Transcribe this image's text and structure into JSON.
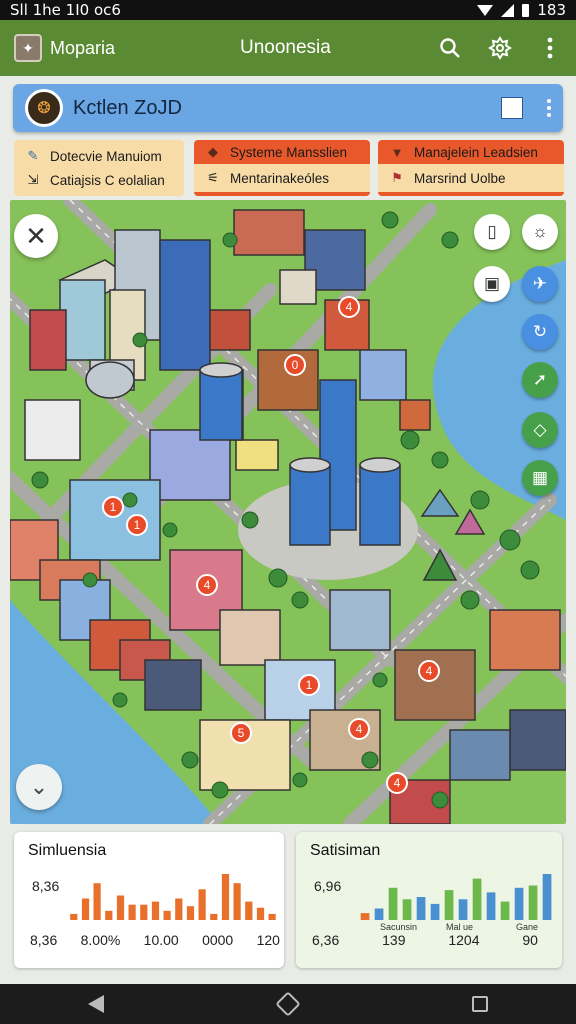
{
  "status_bar": {
    "left_text": "Sll 1he 1I0 oc6",
    "time": "183"
  },
  "app_bar": {
    "app_name": "Moparia",
    "title": "Unoonesia",
    "actions": [
      "search-icon",
      "settings-icon",
      "more-icon"
    ]
  },
  "panel": {
    "title": "Kctlen ZoJD"
  },
  "chips": {
    "left": [
      {
        "label": "Dotecvie Manuiom",
        "icon": "pencil-icon"
      },
      {
        "label": "Catiajsis C eolalian",
        "icon": "export-icon"
      }
    ],
    "middle": [
      {
        "label": "Systeme Mansslien",
        "icon": "shield-icon"
      },
      {
        "label": "Mentarinakeóles",
        "icon": "filter-icon"
      }
    ],
    "right": [
      {
        "label": "Manajelein Leadsien",
        "icon": "badge-icon"
      },
      {
        "label": "Marsrind Uolbe",
        "icon": "flag-icon"
      }
    ]
  },
  "map": {
    "markers": [
      "4",
      "0",
      "1",
      "1",
      "4",
      "1",
      "4",
      "5",
      "4",
      "4"
    ],
    "side_buttons": [
      "device-icon",
      "sun-icon",
      "tablet-icon",
      "wind-icon",
      "refresh-icon",
      "arrow-icon",
      "cube-icon",
      "grid-icon"
    ]
  },
  "cards": {
    "left": {
      "title": "Simluensia",
      "value": "8,36",
      "footer": [
        "8,36",
        "8.00%",
        "10.00",
        "0000",
        "120"
      ],
      "bars": [
        4,
        14,
        24,
        6,
        16,
        10,
        10,
        12,
        6,
        14,
        9,
        20,
        4,
        30,
        24,
        12,
        8,
        4
      ],
      "bar_color": "#e8702a"
    },
    "right": {
      "title": "Satisiman",
      "value": "6,96",
      "footer": [
        "6,36",
        "139",
        "1204",
        "90"
      ],
      "x_labels": [
        "Sacunsin",
        "Mal ue",
        "Gane"
      ],
      "bars": [
        {
          "v": 6,
          "c": "#e8702a"
        },
        {
          "v": 10,
          "c": "#4a90d0"
        },
        {
          "v": 28,
          "c": "#6cb84a"
        },
        {
          "v": 18,
          "c": "#6cb84a"
        },
        {
          "v": 20,
          "c": "#4a90d0"
        },
        {
          "v": 14,
          "c": "#4a90d0"
        },
        {
          "v": 26,
          "c": "#6cb84a"
        },
        {
          "v": 18,
          "c": "#4a90d0"
        },
        {
          "v": 36,
          "c": "#6cb84a"
        },
        {
          "v": 24,
          "c": "#4a90d0"
        },
        {
          "v": 16,
          "c": "#6cb84a"
        },
        {
          "v": 28,
          "c": "#4a90d0"
        },
        {
          "v": 30,
          "c": "#6cb84a"
        },
        {
          "v": 40,
          "c": "#4a90d0"
        }
      ]
    }
  }
}
